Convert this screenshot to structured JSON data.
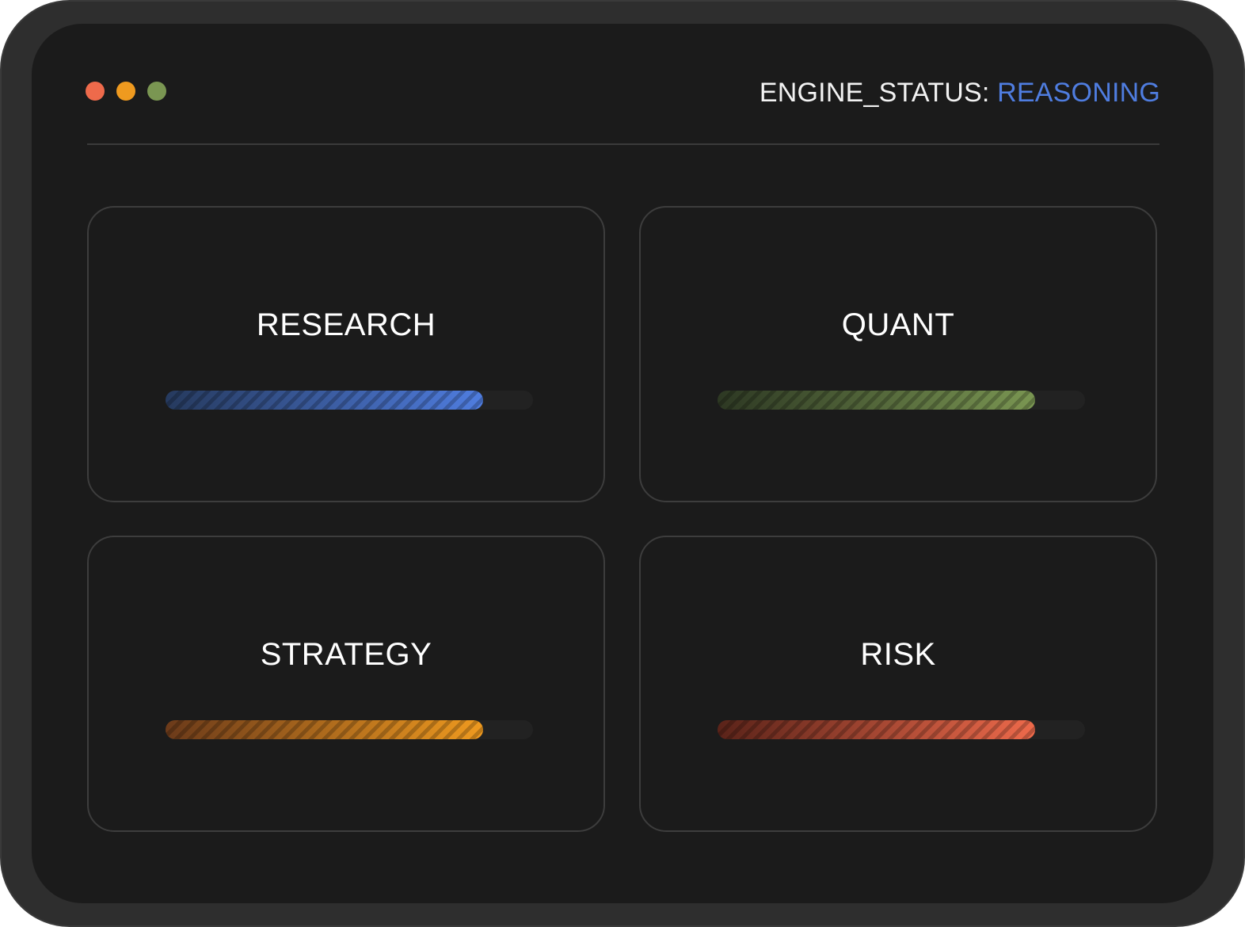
{
  "window": {
    "controls": [
      {
        "name": "close",
        "color": "#ee6a4b"
      },
      {
        "name": "minimize",
        "color": "#ef9a1f"
      },
      {
        "name": "maximize",
        "color": "#7a9652"
      }
    ]
  },
  "header": {
    "status_label": "ENGINE_STATUS:",
    "status_value": "REASONING",
    "status_value_color": "#4f7de0"
  },
  "cards": [
    {
      "title": "RESEARCH",
      "progress": 0.865,
      "color": "#4f7de0",
      "color_dark": "#263a5e"
    },
    {
      "title": "QUANT",
      "progress": 0.865,
      "color": "#7a9652",
      "color_dark": "#2d3823"
    },
    {
      "title": "STRATEGY",
      "progress": 0.865,
      "color": "#ef9a1f",
      "color_dark": "#6b3a1a"
    },
    {
      "title": "RISK",
      "progress": 0.865,
      "color": "#ee6a4b",
      "color_dark": "#5a2319"
    }
  ]
}
